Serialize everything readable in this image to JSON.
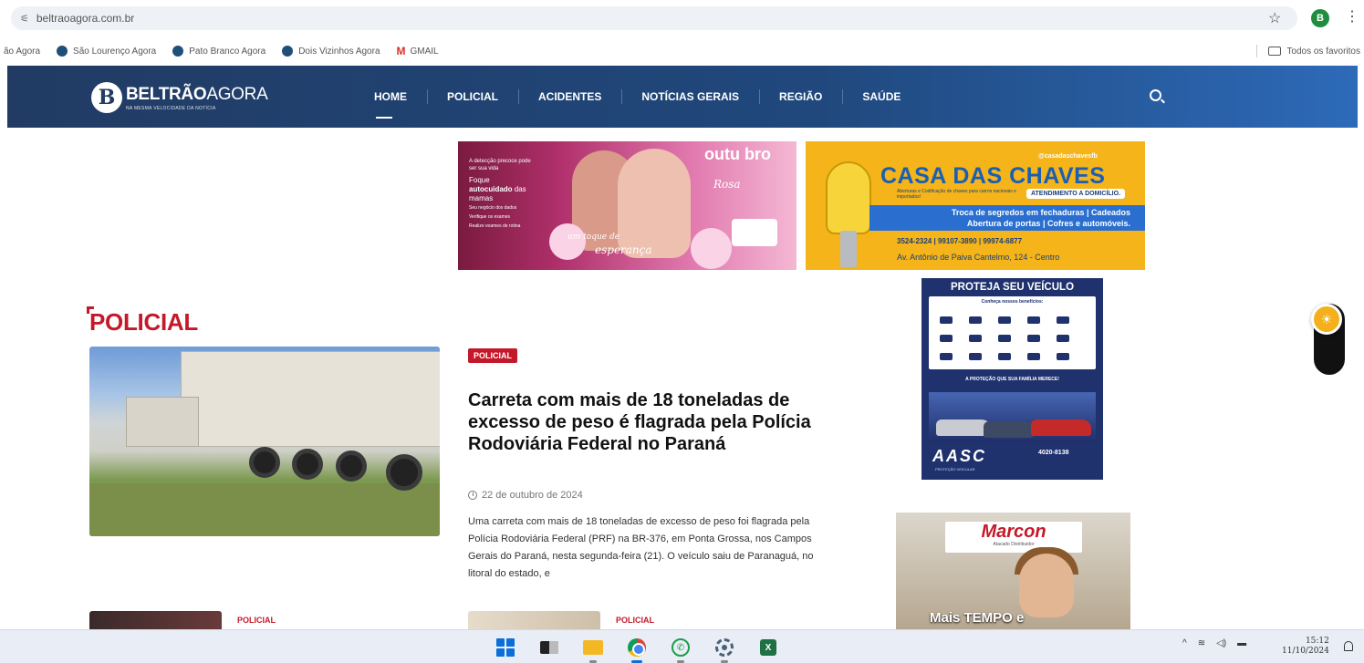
{
  "browser": {
    "url": "beltraoagora.com.br",
    "profile_initial": "B",
    "bookmarks": [
      {
        "label": "ão Agora"
      },
      {
        "label": "São Lourenço Agora"
      },
      {
        "label": "Pato Branco Agora"
      },
      {
        "label": "Dois Vizinhos Agora"
      },
      {
        "label": "GMAIL"
      }
    ],
    "all_bookmarks_label": "Todos os favoritos"
  },
  "site": {
    "logo_letter": "B",
    "logo_bold": "BELTRÃO",
    "logo_thin": "AGORA",
    "logo_tagline": "NA MESMA VELOCIDADE DA NOTÍCIA",
    "nav": [
      "HOME",
      "POLICIAL",
      "ACIDENTES",
      "NOTÍCIAS GERAIS",
      "REGIÃO",
      "SAÚDE"
    ],
    "active_nav": "HOME"
  },
  "banners": {
    "outubro": {
      "small_text": "A detecção precoce pode ser sua vida",
      "headline_1": "Foque ",
      "headline_bold": "autocuidado",
      "headline_2": " das mamas",
      "list": [
        "Seu negócio dos dados",
        "Verifique os exames",
        "Realize exames de rotina"
      ],
      "title": "outu bro",
      "subtitle": "Rosa",
      "tagline_1": "um toque de",
      "tagline_2": "esperança"
    },
    "chaves": {
      "instagram": "@casadaschavesfb",
      "title": "CASA DAS CHAVES",
      "subtitle": "Aberturas e Codificação de chaves para carros nacionais e importados!",
      "atendimento": "ATENDIMENTO A DOMICÍLIO.",
      "service_1": "Troca de segredos em fechaduras | Cadeados",
      "service_2": "Abertura de portas | Cofres e automóveis.",
      "phones": "3524-2324 | 99107-3890 | 99974-6877",
      "address": "Av. Antônio de Paiva Cantelmo, 124 - Centro"
    }
  },
  "section": {
    "title": "POLICIAL"
  },
  "featured": {
    "category": "POLICIAL",
    "title": "Carreta com mais de 18 toneladas de excesso de peso é flagrada pela Polícia Rodoviária Federal no Paraná",
    "date": "22 de outubro de 2024",
    "excerpt": "Uma carreta com mais de 18 toneladas de excesso de peso foi flagrada pela Polícia Rodoviária Federal (PRF) na BR-376, em Ponta Grossa, nos Campos Gerais do Paraná, nesta segunda-feira (21). O veículo saiu de Paranaguá, no litoral do estado, e"
  },
  "next_articles": [
    {
      "category": "POLICIAL"
    },
    {
      "category": "POLICIAL"
    }
  ],
  "ads": {
    "aasc": {
      "title": "PROTEJA SEU VEÍCULO",
      "benefits_heading": "Conheça nossos benefícios:",
      "line": "A PROTEÇÃO QUE SUA FAMÍLIA MERECE!",
      "logo": "AASC",
      "phone": "4020-8138",
      "sub": "PROTEÇÃO VEICULAR"
    },
    "marcon": {
      "logo": "Marcon",
      "sub": "Atacado Distribuidor",
      "text": "Mais TEMPO e"
    }
  },
  "taskbar": {
    "time": "15:12",
    "date": "11/10/2024"
  }
}
